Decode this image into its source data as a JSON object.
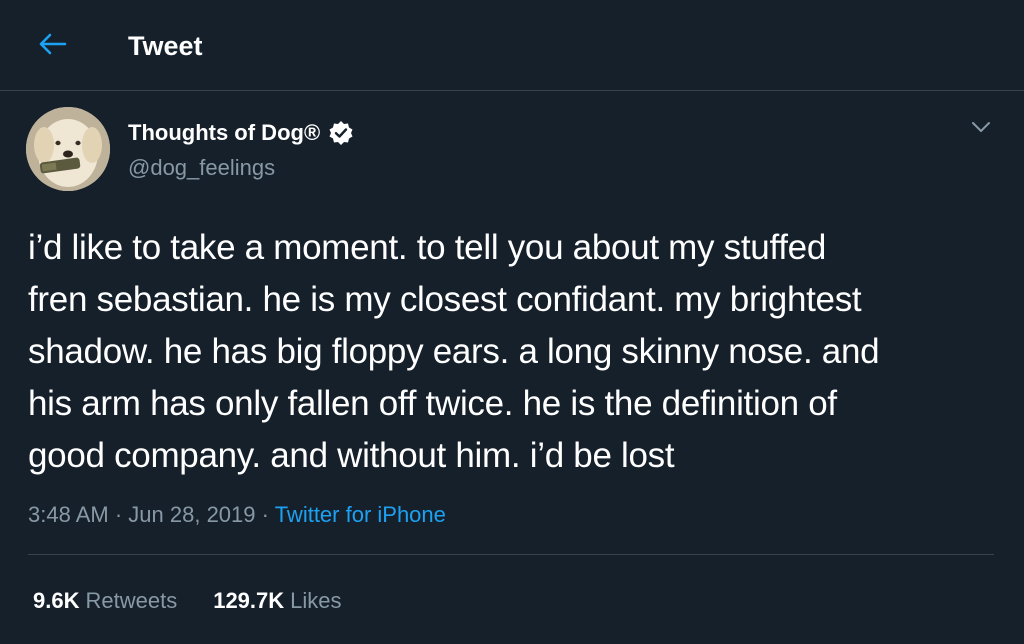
{
  "header": {
    "back_icon": "arrow-left-icon",
    "title": "Tweet",
    "accent_color": "#1da1f2"
  },
  "author": {
    "display_name": "Thoughts of Dog®",
    "handle": "@dog_feelings",
    "verified_icon": "verified-badge-icon",
    "avatar_icon": "dog-avatar"
  },
  "tweet": {
    "text": "i’d like to take a moment. to tell you about my stuffed\nfren sebastian. he is my closest confidant. my brightest\nshadow. he has big floppy ears. a long skinny nose. and\nhis arm has only fallen off twice. he is the definition of\ngood company. and without him. i’d be lost",
    "time": "3:48 AM",
    "date": "Jun 28, 2019",
    "source": "Twitter for iPhone"
  },
  "stats": {
    "retweets_count": "9.6K",
    "retweets_label": "Retweets",
    "likes_count": "129.7K",
    "likes_label": "Likes"
  },
  "colors": {
    "background": "#15202b",
    "divider": "#38444d",
    "secondary_text": "#8899a6",
    "link": "#1da1f2"
  }
}
